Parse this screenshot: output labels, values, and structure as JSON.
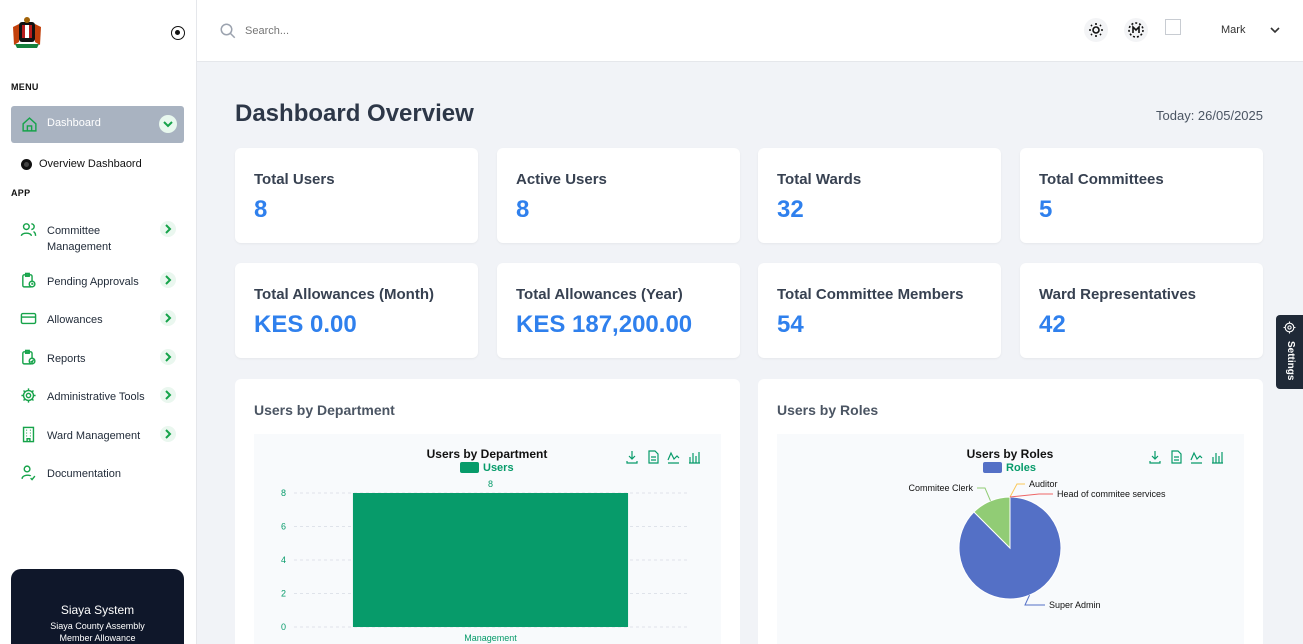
{
  "sidebar": {
    "menu_label": "MENU",
    "app_label": "APP",
    "active_item": {
      "label": "Dashboard",
      "icon": "home-icon"
    },
    "sub_item": {
      "label": "Overview Dashbaord"
    },
    "items": [
      {
        "label": "Committee Management",
        "icon": "users-icon"
      },
      {
        "label": "Pending Approvals",
        "icon": "clipboard-clock-icon"
      },
      {
        "label": "Allowances",
        "icon": "credit-card-icon"
      },
      {
        "label": "Reports",
        "icon": "clipboard-report-icon"
      },
      {
        "label": "Administrative Tools",
        "icon": "gear-icon"
      },
      {
        "label": "Ward Management",
        "icon": "building-icon"
      },
      {
        "label": "Documentation",
        "icon": "user-check-icon"
      }
    ],
    "footer": {
      "title": "Siaya System",
      "subtitle_line1": "Siaya County Assembly",
      "subtitle_line2": "Member Allowance"
    }
  },
  "topbar": {
    "search_placeholder": "Search...",
    "user_name": "Mark",
    "buttons": [
      "theme-toggle-icon",
      "mode-m-icon"
    ]
  },
  "main": {
    "title": "Dashboard Overview",
    "today": "Today: 26/05/2025",
    "stats": [
      {
        "label": "Total Users",
        "value": "8"
      },
      {
        "label": "Active Users",
        "value": "8"
      },
      {
        "label": "Total Wards",
        "value": "32"
      },
      {
        "label": "Total Committees",
        "value": "5"
      },
      {
        "label": "Total Allowances (Month)",
        "value": "KES 0.00"
      },
      {
        "label": "Total Allowances (Year)",
        "value": "KES 187,200.00"
      },
      {
        "label": "Total Committee Members",
        "value": "54"
      },
      {
        "label": "Ward Representatives",
        "value": "42"
      }
    ],
    "chart_cards": [
      {
        "card_title": "Users by Department"
      },
      {
        "card_title": "Users by Roles"
      }
    ]
  },
  "settings_tab": {
    "label": "Settings"
  },
  "colors": {
    "accent_green": "#079b6a",
    "stat_blue": "#2f80ed",
    "pie_blue": "#5470c6",
    "pie_green": "#91cc75"
  },
  "chart_data": [
    {
      "type": "bar",
      "title": "Users by Department",
      "legend": "Users",
      "categories": [
        "Management"
      ],
      "series": [
        {
          "name": "Users",
          "values": [
            8
          ]
        }
      ],
      "ylim": [
        0,
        8
      ],
      "yticks": [
        "0",
        "2",
        "4",
        "6",
        "8"
      ],
      "data_labels": [
        "8"
      ],
      "grid": true,
      "legend_position": "top-center"
    },
    {
      "type": "pie",
      "title": "Users by Roles",
      "legend": "Roles",
      "slices": [
        {
          "label": "Super Admin",
          "value": 7
        },
        {
          "label": "Commitee Clerk",
          "value": 1
        },
        {
          "label": "Auditor",
          "value": 0
        },
        {
          "label": "Head of commitee services",
          "value": 0
        }
      ],
      "legend_position": "top-center"
    }
  ]
}
